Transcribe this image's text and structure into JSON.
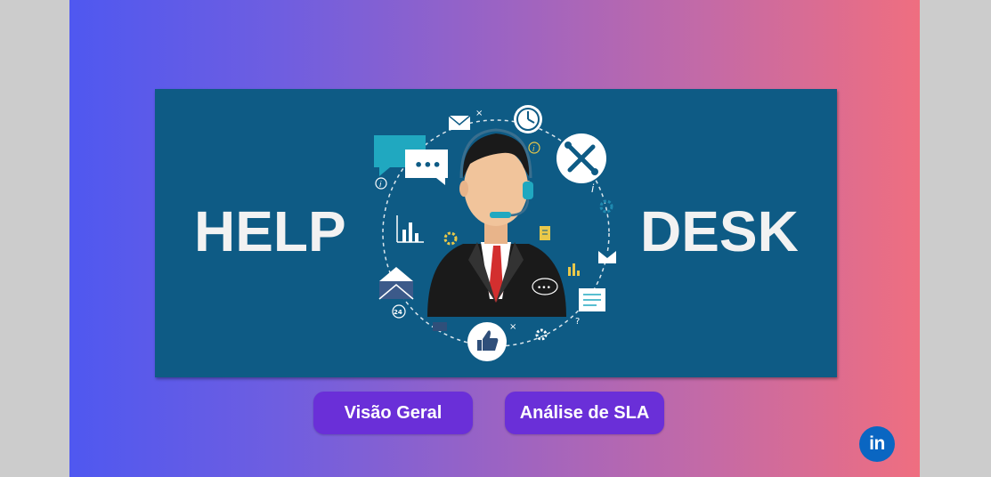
{
  "banner": {
    "left_text": "HELP",
    "right_text": "DESK",
    "chat_dots": "•••",
    "badge_24": "24"
  },
  "nav": {
    "overview_label": "Visão Geral",
    "sla_label": "Análise de SLA"
  },
  "social": {
    "linkedin_label": "in"
  },
  "colors": {
    "banner_bg": "#0e5b85",
    "button_bg": "#6a2fd8",
    "gradient_start": "#4f58f0",
    "gradient_end": "#ef6e80",
    "linkedin": "#0a66c2"
  }
}
